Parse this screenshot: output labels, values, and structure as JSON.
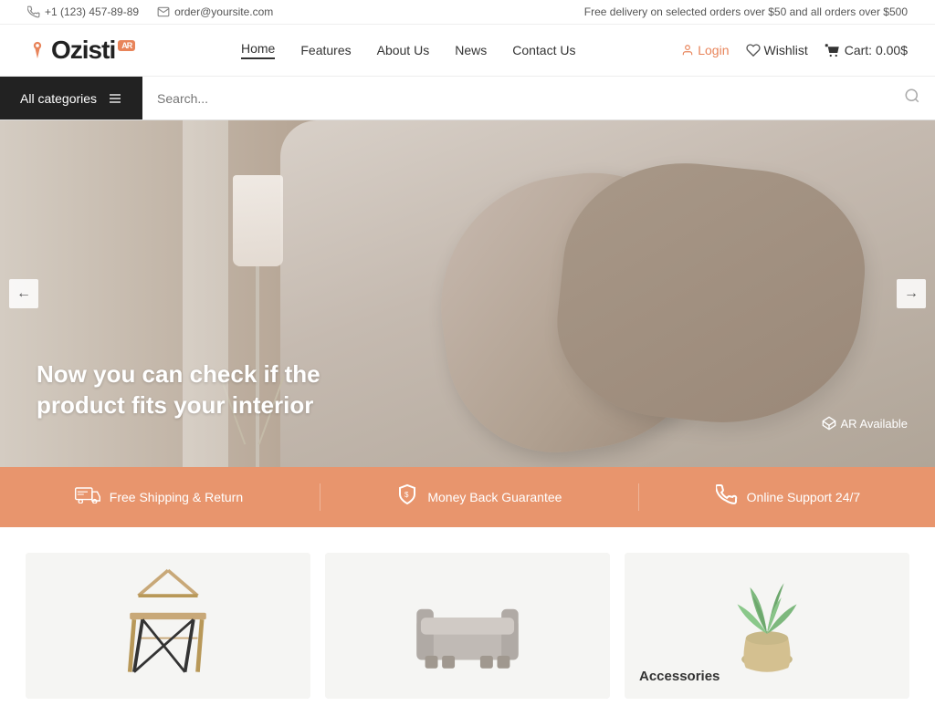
{
  "topbar": {
    "phone": "+1 (123) 457-89-89",
    "email": "order@yoursite.com",
    "promo": "Free delivery on selected orders over $50 and all orders over $500"
  },
  "header": {
    "logo_text": "Ozisti",
    "ar_badge": "AR",
    "nav_items": [
      {
        "label": "Home",
        "active": true
      },
      {
        "label": "Features",
        "active": false
      },
      {
        "label": "About Us",
        "active": false
      },
      {
        "label": "News",
        "active": false
      },
      {
        "label": "Contact Us",
        "active": false
      }
    ],
    "login_label": "Login",
    "wishlist_label": "Wishlist",
    "cart_label": "Cart: 0.00$"
  },
  "search": {
    "categories_label": "All categories",
    "placeholder": "Search..."
  },
  "hero": {
    "title": "Now you can check if the product fits your interior",
    "ar_label": "AR Available"
  },
  "features": [
    {
      "icon": "🚚",
      "label": "Free Shipping & Return"
    },
    {
      "icon": "🛡",
      "label": "Money Back Guarantee"
    },
    {
      "icon": "📞",
      "label": "Online Support 24/7"
    }
  ],
  "products": [
    {
      "label": "",
      "bg": "#f0ede8"
    },
    {
      "label": "",
      "bg": "#eeeceb"
    },
    {
      "label": "Accessories",
      "bg": "#eef2ee"
    }
  ]
}
